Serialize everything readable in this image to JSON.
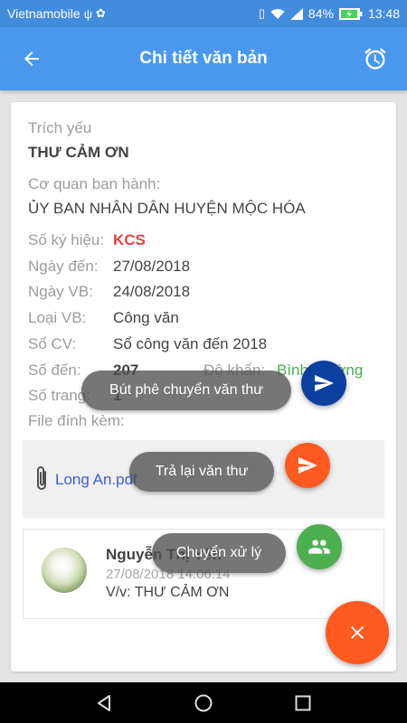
{
  "statusbar": {
    "carrier": "Vietnamobile",
    "battery": "84%",
    "time": "13:48"
  },
  "appbar": {
    "title": "Chi tiết văn bản"
  },
  "doc": {
    "trich_yeu_label": "Trích yếu",
    "trich_yeu_value": "THƯ CẢM ƠN",
    "co_quan_label": "Cơ quan ban hành:",
    "co_quan_value": "ỦY BAN NHÂN DÂN HUYỆN MỘC HÓA",
    "so_ky_hieu_label": "Số ký hiệu:",
    "so_ky_hieu_value": "KCS",
    "ngay_den_label": "Ngày đến:",
    "ngay_den_value": "27/08/2018",
    "ngay_vb_label": "Ngày VB:",
    "ngay_vb_value": "24/08/2018",
    "loai_vb_label": "Loại VB:",
    "loai_vb_value": "Công văn",
    "so_cv_label": "Sổ CV:",
    "so_cv_value": "Sổ công văn đến 2018",
    "so_den_label": "Số đến:",
    "so_den_value": "207",
    "do_khan_label": "Độ khẩn:",
    "do_khan_value": "Bình thường",
    "so_trang_label": "Số trang:",
    "so_trang_value": "1",
    "file_label": "File đính kèm:",
    "file_name": "Long An.pdf"
  },
  "comment": {
    "author": "Nguyễn Thị Yến",
    "timestamp": "27/08/2018 14:06:14",
    "subject": "V/v: THƯ CẢM ƠN"
  },
  "actions": {
    "but_phe": "Bút phê chuyển văn thư",
    "tra_lai": "Trả lại văn thư",
    "chuyen_xu_ly": "Chuyển xử lý"
  },
  "colors": {
    "primary": "#2a86ec",
    "kcs_red": "#e02020",
    "do_khan_green": "#2e9e3a",
    "fab_navy": "#0d3fa0",
    "fab_orange": "#ff5a1f",
    "fab_green": "#4caf50"
  },
  "icons": [
    "back-arrow-icon",
    "alarm-clock-icon",
    "paperclip-icon",
    "send-icon",
    "group-icon",
    "close-icon"
  ]
}
